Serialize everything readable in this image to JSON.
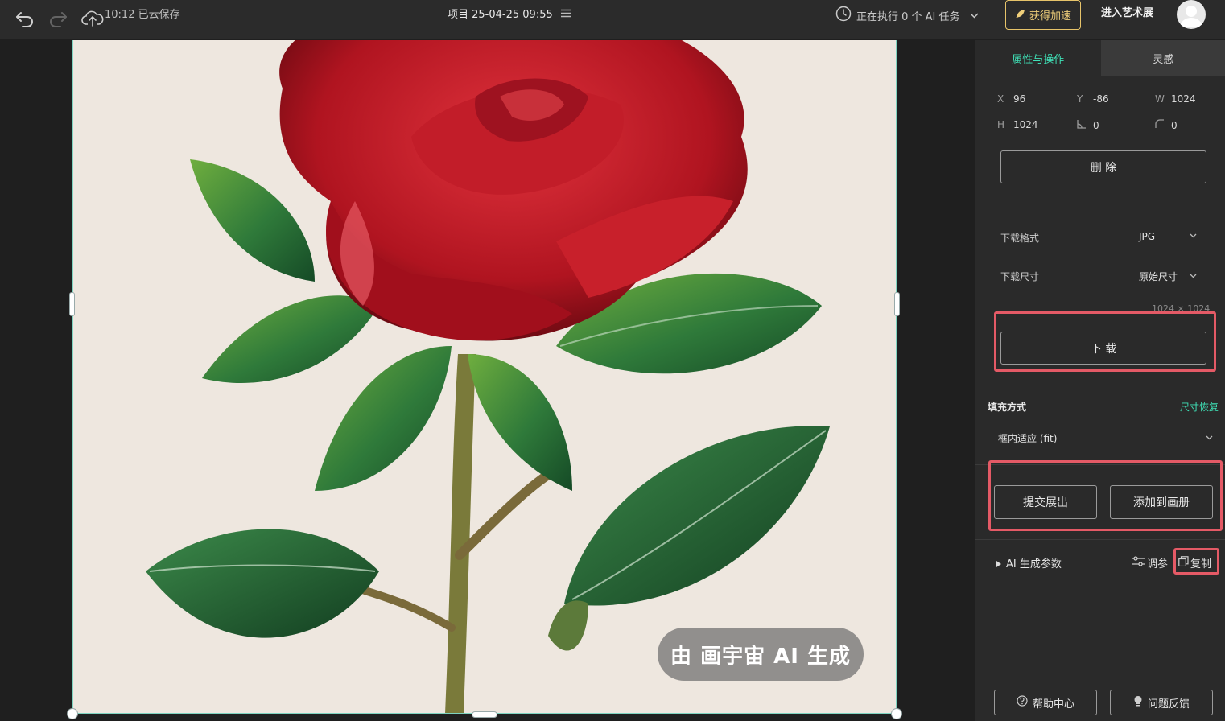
{
  "topbar": {
    "saved_text": "10:12 已云保存",
    "project_title": "项目 25-04-25 09:55",
    "task_status": "正在执行 0 个 AI 任务",
    "boost_label": "获得加速",
    "gallery_label": "进入艺术展"
  },
  "canvas": {
    "watermark": "由 画宇宙 AI 生成"
  },
  "panel": {
    "tabs": [
      {
        "label": "属性与操作",
        "active": true
      },
      {
        "label": "灵感",
        "active": false
      }
    ],
    "props": {
      "x_label": "X",
      "x_value": "96",
      "y_label": "Y",
      "y_value": "-86",
      "w_label": "W",
      "w_value": "1024",
      "h_label": "H",
      "h_value": "1024",
      "angle_value": "0",
      "radius_value": "0"
    },
    "delete_label": "删 除",
    "download_format_label": "下载格式",
    "download_format_value": "JPG",
    "download_size_label": "下载尺寸",
    "download_size_value": "原始尺寸",
    "download_dimensions": "1024 × 1024",
    "download_label": "下 载",
    "fill_mode_label": "填充方式",
    "size_restore_label": "尺寸恢复",
    "fill_mode_value": "框内适应 (fit)",
    "submit_exhibit_label": "提交展出",
    "add_album_label": "添加到画册",
    "ai_params_label": "AI 生成参数",
    "tune_label": "调参",
    "copy_label": "复制",
    "help_label": "帮助中心",
    "feedback_label": "问题反馈"
  },
  "colors": {
    "accent": "#3fe0b6",
    "boost": "#e7c46a",
    "highlight": "#e45a66"
  }
}
